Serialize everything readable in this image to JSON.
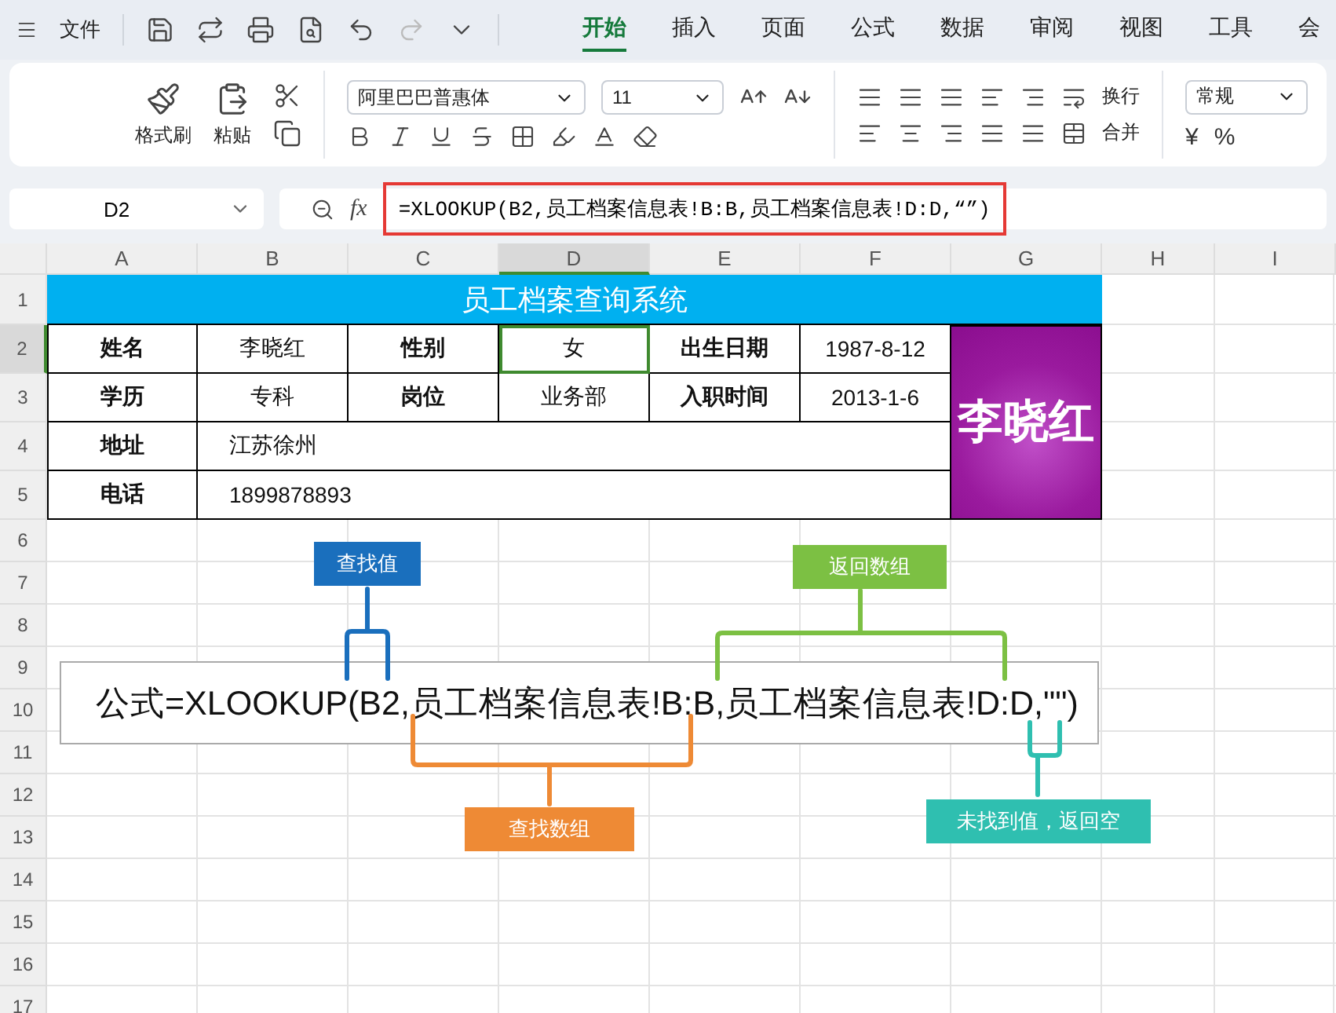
{
  "top_bar": {
    "menu_label": "文件",
    "tabs": [
      {
        "label": "开始",
        "selected": true
      },
      {
        "label": "插入",
        "selected": false
      },
      {
        "label": "页面",
        "selected": false
      },
      {
        "label": "公式",
        "selected": false
      },
      {
        "label": "数据",
        "selected": false
      },
      {
        "label": "审阅",
        "selected": false
      },
      {
        "label": "视图",
        "selected": false
      },
      {
        "label": "工具",
        "selected": false
      },
      {
        "label": "会",
        "selected": false
      }
    ]
  },
  "ribbon": {
    "format_painter": "格式刷",
    "paste": "粘贴",
    "font_name": "阿里巴巴普惠体",
    "font_size": "11",
    "wrap": "换行",
    "merge": "合并",
    "number_format": "常规",
    "currency": "¥",
    "percent": "%"
  },
  "formula_bar": {
    "name_box": "D2",
    "fx": "fx",
    "formula": "=XLOOKUP(B2,员工档案信息表!B:B,员工档案信息表!D:D,“”)"
  },
  "columns": [
    {
      "label": "A",
      "selected": false
    },
    {
      "label": "B",
      "selected": false
    },
    {
      "label": "C",
      "selected": false
    },
    {
      "label": "D",
      "selected": true
    },
    {
      "label": "E",
      "selected": false
    },
    {
      "label": "F",
      "selected": false
    },
    {
      "label": "G",
      "selected": false
    },
    {
      "label": "H",
      "selected": false
    },
    {
      "label": "I",
      "selected": false
    }
  ],
  "rows": [
    {
      "label": "1",
      "selected": false
    },
    {
      "label": "2",
      "selected": true
    },
    {
      "label": "3",
      "selected": false
    },
    {
      "label": "4",
      "selected": false
    },
    {
      "label": "5",
      "selected": false
    },
    {
      "label": "6",
      "selected": false
    },
    {
      "label": "7",
      "selected": false
    },
    {
      "label": "8",
      "selected": false
    },
    {
      "label": "9",
      "selected": false
    },
    {
      "label": "10",
      "selected": false
    },
    {
      "label": "11",
      "selected": false
    },
    {
      "label": "12",
      "selected": false
    },
    {
      "label": "13",
      "selected": false
    },
    {
      "label": "14",
      "selected": false
    },
    {
      "label": "15",
      "selected": false
    },
    {
      "label": "16",
      "selected": false
    },
    {
      "label": "17",
      "selected": false
    }
  ],
  "card": {
    "title": "员工档案查询系统",
    "photo_text": "李晓红",
    "rows": [
      [
        {
          "text": "姓名",
          "kind": "label",
          "selected": false
        },
        {
          "text": "李晓红",
          "kind": "value",
          "selected": false
        },
        {
          "text": "性别",
          "kind": "label",
          "selected": false
        },
        {
          "text": "女",
          "kind": "value",
          "selected": true
        },
        {
          "text": "出生日期",
          "kind": "label",
          "selected": false
        },
        {
          "text": "1987-8-12",
          "kind": "value",
          "selected": false
        }
      ],
      [
        {
          "text": "学历",
          "kind": "label",
          "selected": false
        },
        {
          "text": "专科",
          "kind": "value",
          "selected": false
        },
        {
          "text": "岗位",
          "kind": "label",
          "selected": false
        },
        {
          "text": "业务部",
          "kind": "value",
          "selected": false
        },
        {
          "text": "入职时间",
          "kind": "label",
          "selected": false
        },
        {
          "text": "2013-1-6",
          "kind": "value",
          "selected": false
        }
      ],
      [
        {
          "text": "地址",
          "kind": "label",
          "selected": false
        },
        {
          "text": "江苏徐州",
          "kind": "wide",
          "selected": false
        }
      ],
      [
        {
          "text": "电话",
          "kind": "label",
          "selected": false
        },
        {
          "text": "1899878893",
          "kind": "wide",
          "selected": false
        }
      ]
    ]
  },
  "annotation": {
    "formula": "公式=XLOOKUP(B2,员工档案信息表!B:B,员工档案信息表!D:D,\"\")",
    "callouts": [
      {
        "label": "查找值",
        "color": "#1a6fbd"
      },
      {
        "label": "返回数组",
        "color": "#7cc043"
      },
      {
        "label": "查找数组",
        "color": "#ee8a35"
      },
      {
        "label": "未找到值，返回空",
        "color": "#2fbfb0"
      }
    ]
  }
}
